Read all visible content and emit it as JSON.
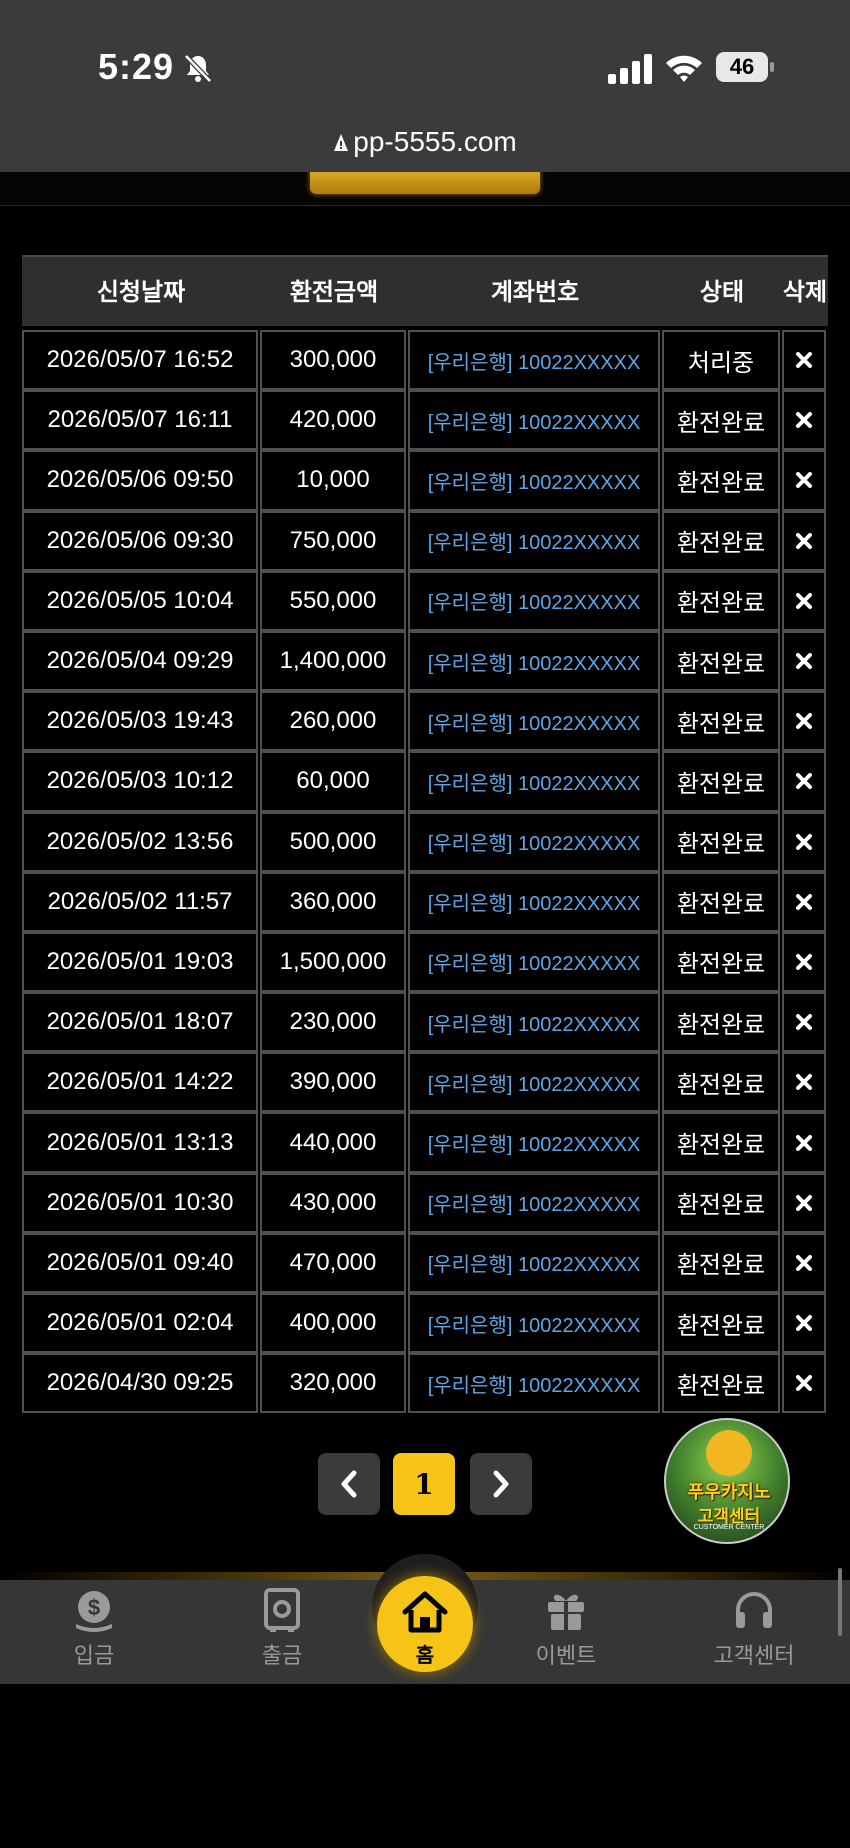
{
  "status_bar": {
    "time": "5:29",
    "battery": "46"
  },
  "browser": {
    "url": "pp-5555.com"
  },
  "table": {
    "headers": [
      "신청날짜",
      "환전금액",
      "계좌번호",
      "상태",
      "삭제"
    ],
    "rows": [
      {
        "date": "2026/05/07 16:52",
        "amount": "300,000",
        "account": "[우리은행] 10022XXXXX",
        "status": "처리중"
      },
      {
        "date": "2026/05/07 16:11",
        "amount": "420,000",
        "account": "[우리은행] 10022XXXXX",
        "status": "환전완료"
      },
      {
        "date": "2026/05/06 09:50",
        "amount": "10,000",
        "account": "[우리은행] 10022XXXXX",
        "status": "환전완료"
      },
      {
        "date": "2026/05/06 09:30",
        "amount": "750,000",
        "account": "[우리은행] 10022XXXXX",
        "status": "환전완료"
      },
      {
        "date": "2026/05/05 10:04",
        "amount": "550,000",
        "account": "[우리은행] 10022XXXXX",
        "status": "환전완료"
      },
      {
        "date": "2026/05/04 09:29",
        "amount": "1,400,000",
        "account": "[우리은행] 10022XXXXX",
        "status": "환전완료"
      },
      {
        "date": "2026/05/03 19:43",
        "amount": "260,000",
        "account": "[우리은행] 10022XXXXX",
        "status": "환전완료"
      },
      {
        "date": "2026/05/03 10:12",
        "amount": "60,000",
        "account": "[우리은행] 10022XXXXX",
        "status": "환전완료"
      },
      {
        "date": "2026/05/02 13:56",
        "amount": "500,000",
        "account": "[우리은행] 10022XXXXX",
        "status": "환전완료"
      },
      {
        "date": "2026/05/02 11:57",
        "amount": "360,000",
        "account": "[우리은행] 10022XXXXX",
        "status": "환전완료"
      },
      {
        "date": "2026/05/01 19:03",
        "amount": "1,500,000",
        "account": "[우리은행] 10022XXXXX",
        "status": "환전완료"
      },
      {
        "date": "2026/05/01 18:07",
        "amount": "230,000",
        "account": "[우리은행] 10022XXXXX",
        "status": "환전완료"
      },
      {
        "date": "2026/05/01 14:22",
        "amount": "390,000",
        "account": "[우리은행] 10022XXXXX",
        "status": "환전완료"
      },
      {
        "date": "2026/05/01 13:13",
        "amount": "440,000",
        "account": "[우리은행] 10022XXXXX",
        "status": "환전완료"
      },
      {
        "date": "2026/05/01 10:30",
        "amount": "430,000",
        "account": "[우리은행] 10022XXXXX",
        "status": "환전완료"
      },
      {
        "date": "2026/05/01 09:40",
        "amount": "470,000",
        "account": "[우리은행] 10022XXXXX",
        "status": "환전완료"
      },
      {
        "date": "2026/05/01 02:04",
        "amount": "400,000",
        "account": "[우리은행] 10022XXXXX",
        "status": "환전완료"
      },
      {
        "date": "2026/04/30 09:25",
        "amount": "320,000",
        "account": "[우리은행] 10022XXXXX",
        "status": "환전완료"
      }
    ],
    "delete_icon": "close-icon"
  },
  "pagination": {
    "current_page": "1"
  },
  "customer_center_badge": {
    "line1": "푸우카지노",
    "line2": "고객센터",
    "line3": "CUSTOMER CENTER"
  },
  "bottom_nav": {
    "items": [
      {
        "label": "입금",
        "icon": "dollar-coin-icon"
      },
      {
        "label": "출금",
        "icon": "safe-icon"
      },
      {
        "label": "홈",
        "icon": "home-icon"
      },
      {
        "label": "이벤트",
        "icon": "gift-icon"
      },
      {
        "label": "고객센터",
        "icon": "headset-icon"
      }
    ]
  },
  "colors": {
    "accent": "#f6c417",
    "account_text": "#5ea6e6",
    "background": "#000000"
  }
}
